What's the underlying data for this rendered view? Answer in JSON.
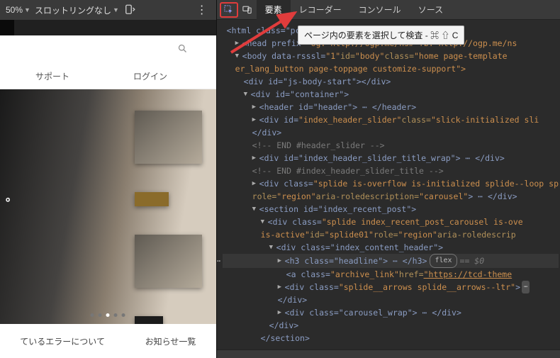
{
  "left": {
    "zoom": "50%",
    "throttling": "スロットリングなし",
    "nav": {
      "support": "サポート",
      "login": "ログイン"
    },
    "hero": {
      "caption_suffix": "。"
    },
    "bottom": {
      "left": "ているエラーについて",
      "right": "お知らせ一覧"
    }
  },
  "devtools": {
    "inspect_tooltip": "ページ内の要素を選択して検査 - ⌘ ⇧ C",
    "tabs": {
      "elements": "要素",
      "recorder": "レコーダー",
      "console": "コンソール",
      "source": "ソース"
    }
  },
  "dom": {
    "l0": "<html class=\"pc\" lang=\"ja\">",
    "l1_a": "<head prefix=",
    "l1_b": "\"og: http://ogp.me/ns# fb: http://ogp.me/ns",
    "l2_a": "<body data-rsssl=",
    "l2_b": "\"1\"",
    "l2_c": " id=",
    "l2_d": "\"body\"",
    "l2_e": " class=",
    "l2_f": "\"home page-template",
    "l2_g": "er_lang_button page-toppage customize-support\">",
    "l3": "<div id=\"js-body-start\"></div>",
    "l4": "<div id=\"container\">",
    "l5": "<header id=\"header\"> ⋯ </header>",
    "l6_a": "<div id=",
    "l6_b": "\"index_header_slider\"",
    "l6_c": " class=",
    "l6_d": "\"slick-initialized sli",
    "l6_e": "</div>",
    "l7": "<!-- END #header_slider -->",
    "l8": "<div id=\"index_header_slider_title_wrap\"> ⋯ </div>",
    "l9": "<!-- END #index_header_slider_title -->",
    "l10_a": "<div class=",
    "l10_b": "\"splide is-overflow is-initialized splide--loop sp",
    "l10_c": "role=",
    "l10_d": "\"region\"",
    "l10_e": " aria-roledescription=",
    "l10_f": "\"carousel\"",
    "l10_g": "> ⋯ </div>",
    "l11": "<section id=\"index_recent_post\">",
    "l12_a": "<div class=",
    "l12_b": "\"splide index_recent_post_carousel is-ove",
    "l12_c": "is-active\"",
    "l12_d": " id=",
    "l12_e": "\"splide01\"",
    "l12_f": " role=",
    "l12_g": "\"region\"",
    "l12_h": " aria-roledescrip",
    "l13": "<div class=\"index_content_header\">",
    "l14": "<h3 class=\"headline\"> ⋯ </h3>",
    "l14_eq": "== $0",
    "l14_flex": "flex",
    "l15_a": "<a class=",
    "l15_b": "\"archive_link\"",
    "l15_c": " href=",
    "l15_d": "\"https://tcd-theme",
    "l16_a": "<div class=",
    "l16_b": "\"splide__arrows splide__arrows--ltr\"",
    "l16_c": ">",
    "l17": "</div>",
    "l18": "<div class=\"carousel_wrap\"> ⋯ </div>",
    "l19": "</div>",
    "l20": "</section>"
  }
}
